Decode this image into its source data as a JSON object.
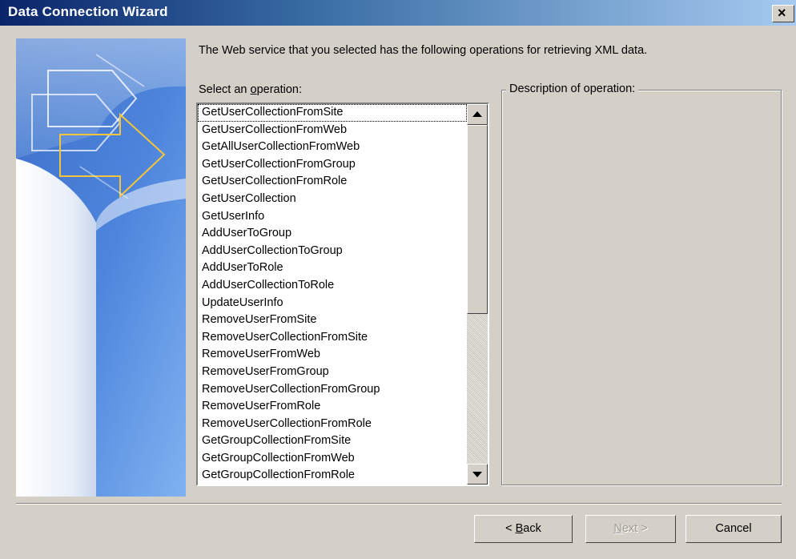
{
  "window": {
    "title": "Data Connection Wizard",
    "close_glyph": "×"
  },
  "intro_text": "The Web service that you selected has the following operations for retrieving XML data.",
  "select_label": {
    "before": "Select an ",
    "mnemonic": "o",
    "after": "peration:"
  },
  "operations": {
    "items": [
      "GetUserCollectionFromSite",
      "GetUserCollectionFromWeb",
      "GetAllUserCollectionFromWeb",
      "GetUserCollectionFromGroup",
      "GetUserCollectionFromRole",
      "GetUserCollection",
      "GetUserInfo",
      "AddUserToGroup",
      "AddUserCollectionToGroup",
      "AddUserToRole",
      "AddUserCollectionToRole",
      "UpdateUserInfo",
      "RemoveUserFromSite",
      "RemoveUserCollectionFromSite",
      "RemoveUserFromWeb",
      "RemoveUserFromGroup",
      "RemoveUserCollectionFromGroup",
      "RemoveUserFromRole",
      "RemoveUserCollectionFromRole",
      "GetGroupCollectionFromSite",
      "GetGroupCollectionFromWeb",
      "GetGroupCollectionFromRole"
    ],
    "focused_index": 0
  },
  "description_label": "Description of operation:",
  "buttons": {
    "back": {
      "before": "< ",
      "mnemonic": "B",
      "after": "ack",
      "enabled": true
    },
    "next": {
      "before": "",
      "mnemonic": "N",
      "after": "ext >",
      "enabled": false
    },
    "cancel": {
      "label": "Cancel",
      "enabled": true
    }
  },
  "colors": {
    "dialog_bg": "#d4d0c8",
    "titlebar_start": "#0a246a",
    "titlebar_end": "#a6caf0",
    "art_accent": "#f4c53b"
  },
  "icons": {
    "close": "close-icon",
    "scroll_up": "scroll-up-arrow-icon",
    "scroll_down": "scroll-down-arrow-icon",
    "wizard_art": "wizard-arrow-graphic"
  }
}
